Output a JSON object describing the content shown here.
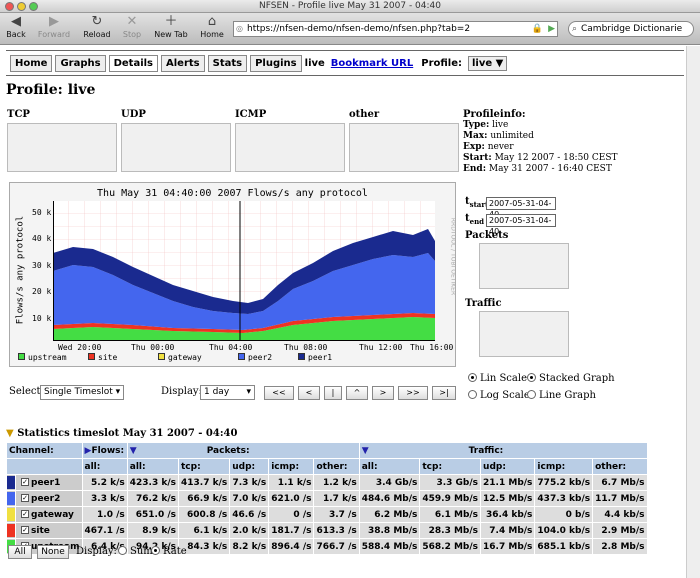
{
  "window": {
    "title": "NFSEN - Profile live May 31 2007 - 04:40"
  },
  "toolbar": {
    "back": "Back",
    "forward": "Forward",
    "reload": "Reload",
    "stop": "Stop",
    "newtab": "New Tab",
    "home": "Home",
    "url": "https://nfsen-demo/nfsen-demo/nfsen.php?tab=2",
    "search": "Cambridge Dictionarie"
  },
  "nav": {
    "tabs": [
      "Home",
      "Graphs",
      "Details",
      "Alerts",
      "Stats",
      "Plugins"
    ],
    "live": "live",
    "bookmark": "Bookmark URL",
    "profile_label": "Profile:",
    "profile_value": "live"
  },
  "page": {
    "title": "Profile: live"
  },
  "small_graphs": [
    "TCP",
    "UDP",
    "ICMP",
    "other"
  ],
  "profileinfo": {
    "heading": "Profileinfo:",
    "rows": [
      [
        "Type:",
        "live"
      ],
      [
        "Max:",
        "unlimited"
      ],
      [
        "Exp:",
        "never"
      ],
      [
        "Start:",
        "May 12 2007 - 18:50 CEST"
      ],
      [
        "End:",
        "May 31 2007 - 16:40 CEST"
      ]
    ]
  },
  "main_graph": {
    "title": "Thu May 31 04:40:00 2007 Flows/s any protocol",
    "ylabel": "Flows/s any protocol",
    "side_text": "RRDTOOL / TOBI OETIKER",
    "yticks": [
      "50 k",
      "40 k",
      "30 k",
      "20 k",
      "10 k"
    ],
    "xticks": [
      "Wed 20:00",
      "Thu 00:00",
      "Thu 04:00",
      "Thu 08:00",
      "Thu 12:00",
      "Thu 16:00"
    ],
    "legend": [
      "upstream",
      "site",
      "gateway",
      "peer2",
      "peer1"
    ]
  },
  "time": {
    "start_label": "t",
    "start_sub": "start",
    "start": "2007-05-31-04-40",
    "end_label": "t",
    "end_sub": "end",
    "end": "2007-05-31-04-40",
    "packets": "Packets",
    "traffic": "Traffic"
  },
  "controls": {
    "select_label": "Select",
    "select_value": "Single Timeslot",
    "display_label": "Display:",
    "display_value": "1 day",
    "nav_buttons": [
      "<<",
      "<",
      "|",
      "^",
      ">",
      ">>",
      ">|"
    ],
    "lin": "Lin Scale",
    "log": "Log Scale",
    "stacked": "Stacked Graph",
    "line": "Line Graph"
  },
  "stats": {
    "heading": "Statistics timeslot May 31 2007 - 04:40",
    "channel_label": "Channel:",
    "flows_label": "Flows:",
    "packets_label": "Packets:",
    "traffic_label": "Traffic:",
    "subheaders": [
      "all:",
      "all:",
      "tcp:",
      "udp:",
      "icmp:",
      "other:",
      "all:",
      "tcp:",
      "udp:",
      "icmp:",
      "other:"
    ],
    "rows": [
      {
        "name": "peer1",
        "color": "#1a2a8f",
        "values": [
          "5.2 k/s",
          "423.3 k/s",
          "413.7 k/s",
          "7.3 k/s",
          "1.1 k/s",
          "1.2 k/s",
          "3.4 Gb/s",
          "3.3 Gb/s",
          "21.1 Mb/s",
          "775.2 kb/s",
          "6.7 Mb/s"
        ]
      },
      {
        "name": "peer2",
        "color": "#4466ee",
        "values": [
          "3.3 k/s",
          "76.2 k/s",
          "66.9 k/s",
          "7.0 k/s",
          "621.0 /s",
          "1.7 k/s",
          "484.6 Mb/s",
          "459.9 Mb/s",
          "12.5 Mb/s",
          "437.3 kb/s",
          "11.7 Mb/s"
        ]
      },
      {
        "name": "gateway",
        "color": "#f0e040",
        "values": [
          "1.0 /s",
          "651.0 /s",
          "600.8 /s",
          "46.6 /s",
          "0 /s",
          "3.7 /s",
          "6.2 Mb/s",
          "6.1 Mb/s",
          "36.4 kb/s",
          "0 b/s",
          "4.4 kb/s"
        ]
      },
      {
        "name": "site",
        "color": "#ee3322",
        "values": [
          "467.1 /s",
          "8.9 k/s",
          "6.1 k/s",
          "2.0 k/s",
          "181.7 /s",
          "613.3 /s",
          "38.8 Mb/s",
          "28.3 Mb/s",
          "7.4 Mb/s",
          "104.0 kb/s",
          "2.9 Mb/s"
        ]
      },
      {
        "name": "upstream",
        "color": "#44dd44",
        "values": [
          "6.4 k/s",
          "94.2 k/s",
          "84.3 k/s",
          "8.2 k/s",
          "896.4 /s",
          "766.7 /s",
          "588.4 Mb/s",
          "568.2 Mb/s",
          "16.7 Mb/s",
          "685.1 kb/s",
          "2.8 Mb/s"
        ]
      }
    ],
    "all_button": "All",
    "none_button": "None",
    "display_label": "Display:",
    "sum": "Sum",
    "rate": "Rate"
  }
}
